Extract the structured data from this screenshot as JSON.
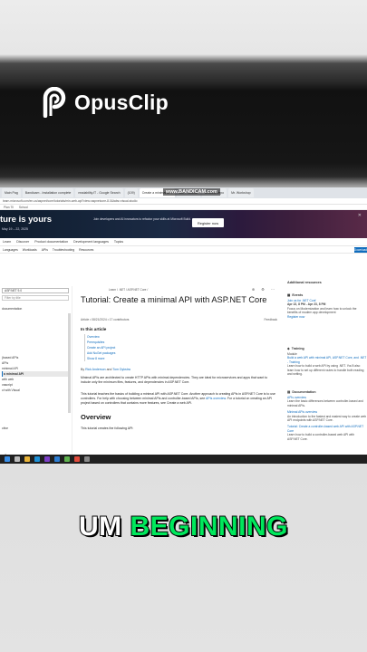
{
  "overlay": {
    "logo_text": "OpusClip"
  },
  "browser": {
    "tabs": [
      "Main Pag",
      "Bandicam - Installation complete",
      "readability.IT - Google Search",
      "(109)",
      "Create a minimal API",
      "curl - Tutorial",
      "Untitled Repo",
      "Mr. Workshop"
    ],
    "recorder_label": "www.BANDICAM.com",
    "address": "learn.microsoft.com/en-us/aspnet/core/tutorials/min-web-api?view=aspnetcore-8.0&tabs=visual-studio",
    "bookmarks": [
      "Plan Til",
      "School"
    ]
  },
  "banner": {
    "title": "ture is yours",
    "dates": "May 19 – 22, 2025",
    "description": "Join developers and AI innovators to refactor your skills at Microsoft Build.",
    "register": "Register now"
  },
  "sitenav": [
    "Learn",
    "Discover",
    "Product documentation",
    "Development languages",
    "Topics"
  ],
  "subnav": [
    "Languages",
    "Workloads",
    "APIs",
    "Troubleshooting",
    "Resources"
  ],
  "download": "Download",
  "leftnav": {
    "version": "ASP.NET 9.0",
    "filter": "Filter by title",
    "items": [
      "documentation",
      "",
      "",
      "",
      "",
      "",
      "",
      "",
      "",
      "(based APIs",
      "APIs",
      "minimal API",
      "a minimal API",
      "with web",
      "vascript",
      "ct with Visual",
      "",
      "",
      "",
      "",
      "",
      "",
      "ctive",
      "",
      "",
      "",
      "",
      "e Core apps"
    ]
  },
  "article": {
    "breadcrumb": "Learn / .NET / ASP.NET Core /",
    "title": "Tutorial: Create a minimal API with ASP.NET Core",
    "meta": "Article • 08/21/2024 • 17 contributors",
    "feedback": "Feedback",
    "in_article": "In this article",
    "toc": [
      "Overview",
      "Prerequisites",
      "Create an API project",
      "Add NuGet packages",
      "Show 8 more"
    ],
    "authors_prefix": "By ",
    "author1": "Rick Anderson",
    "author_and": " and ",
    "author2": "Tom Dykstra",
    "p1": "Minimal APIs are architected to create HTTP APIs with minimal dependencies. They are ideal for microservices and apps that want to include only the minimum files, features, and dependencies in ASP.NET Core.",
    "p2_a": "This tutorial teaches the basics of building a minimal API with ASP.NET Core. Another approach to creating APIs in ASP.NET Core is to use controllers. For help with choosing between minimal APIs and controller-based APIs, see ",
    "p2_link": "APIs overview",
    "p2_b": ". For a tutorial on creating an API project based on controllers that contains more features, see Create a web API.",
    "h_overview": "Overview",
    "p3": "This tutorial creates the following API:"
  },
  "rightpane": {
    "heading": "Additional resources",
    "events_h": "Events",
    "events_link": "Join us for .NET Conf",
    "events_date": "Apr 22, 8 PM - Apr 23, 8 PM",
    "events_text": "Focus on Modernization and learn how to unlock the benefits of modern app development",
    "events_register": "Register now",
    "training_h": "Training",
    "training_module": "Module",
    "training_link": "Build a web API with minimal API, ASP.NET Core, and .NET - Training",
    "training_text": "Learn how to build a web API by using .NET. You'll also learn how to set up different routes to handle both reading and writing.",
    "docs_h": "Documentation",
    "docs1": "APIs overview",
    "docs1_text": "Learn the basic differences between controller-based and minimal APIs.",
    "docs2": "Minimal APIs overview",
    "docs2_text": "An introduction to the fastest and easiest way to create web API endpoints with ASP.NET Core.",
    "docs3": "Tutorial: Create a controller-based web API with ASP.NET Core",
    "docs3_text": "Learn how to build a controller-based web API with ASP.NET Core."
  },
  "caption": {
    "word1": "UM",
    "word2": "BEGINNING"
  }
}
